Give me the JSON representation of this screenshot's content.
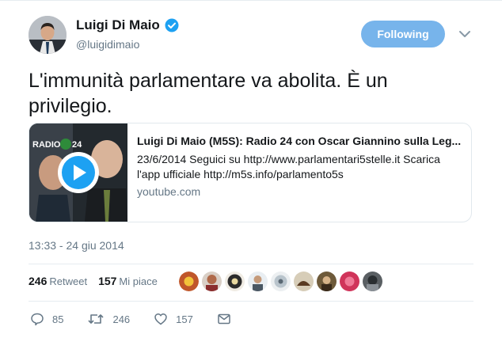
{
  "user": {
    "name": "Luigi Di Maio",
    "handle": "@luigidimaio"
  },
  "follow_button": {
    "label": "Following"
  },
  "tweet": {
    "text": "L'immunità parlamentare va abolita. È un privilegio."
  },
  "card": {
    "title": "Luigi Di Maio (M5S): Radio 24 con Oscar Giannino sulla Leg...",
    "description": "23/6/2014 Seguici su http://www.parlamentari5stelle.it Scarica l'app ufficiale http://m5s.info/parlamento5s",
    "domain": "youtube.com",
    "thumb_logo": "RADIO 24"
  },
  "timestamp": "13:33 - 24 giu 2014",
  "stats": {
    "retweets_count": "246",
    "retweets_label": "Retweet",
    "likes_count": "157",
    "likes_label": "Mi piace"
  },
  "actions": {
    "replies": "85",
    "retweets": "246",
    "likes": "157"
  },
  "colors": {
    "accent": "#1da1f2",
    "follow_button_bg": "#77b4eb",
    "muted_text": "#657786"
  },
  "icons": [
    "verified-badge-icon",
    "chevron-down-icon",
    "play-icon",
    "reply-icon",
    "retweet-icon",
    "heart-icon",
    "envelope-icon"
  ]
}
